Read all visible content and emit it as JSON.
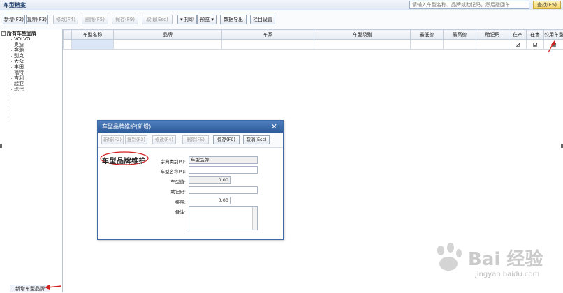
{
  "window": {
    "title": "车型档案",
    "search_placeholder": "请输入车型名称、品牌或助记码，然后敲回车",
    "search_button": "查找(F5)"
  },
  "toolbar": {
    "add": "新增(F2)",
    "copy": "复制(F3)",
    "edit": "修改(F4)",
    "delete": "删除(F5)",
    "save": "保存(F9)",
    "cancel": "取消(Esc)",
    "print": "打印",
    "preview": "预览",
    "export": "数据导出",
    "columns": "栏目设置"
  },
  "tree": {
    "root": "所有车型品牌",
    "items": [
      "VOLVO",
      "奥迪",
      "奔驰",
      "别克",
      "大众",
      "丰田",
      "福特",
      "吉利",
      "起亚",
      "现代"
    ],
    "add_button": "新增车型品牌"
  },
  "grid": {
    "columns": [
      "车型名称",
      "品牌",
      "车系",
      "车型级别",
      "最低价",
      "最高价",
      "助记码",
      "在产",
      "在售",
      "公用车型"
    ]
  },
  "dialog": {
    "title": "车型品牌维护(新增)",
    "toolbar": {
      "add": "新增(F2)",
      "copy": "复制(F3)",
      "edit": "修改(F4)",
      "delete": "删除(F5)",
      "save": "保存(F9)",
      "cancel": "取消(Esc)"
    },
    "section_title": "车型品牌维护",
    "fields": {
      "dict_label": "字典类别(*):",
      "dict_value": "车型品牌",
      "name_label": "车型名称(*):",
      "name_value": "",
      "value_label": "车型值:",
      "value_value": "0.00",
      "mnemonic_label": "助记码:",
      "mnemonic_value": "",
      "order_label": "排序:",
      "order_value": "0.00",
      "note_label": "备注:",
      "note_value": ""
    }
  },
  "watermark": {
    "text": "Bai 经验",
    "url": "jingyan.baidu.com"
  },
  "colors": {
    "dialog_title": "#3566a8",
    "annotation_red": "#d22020",
    "search_button": "#f3d36a"
  }
}
